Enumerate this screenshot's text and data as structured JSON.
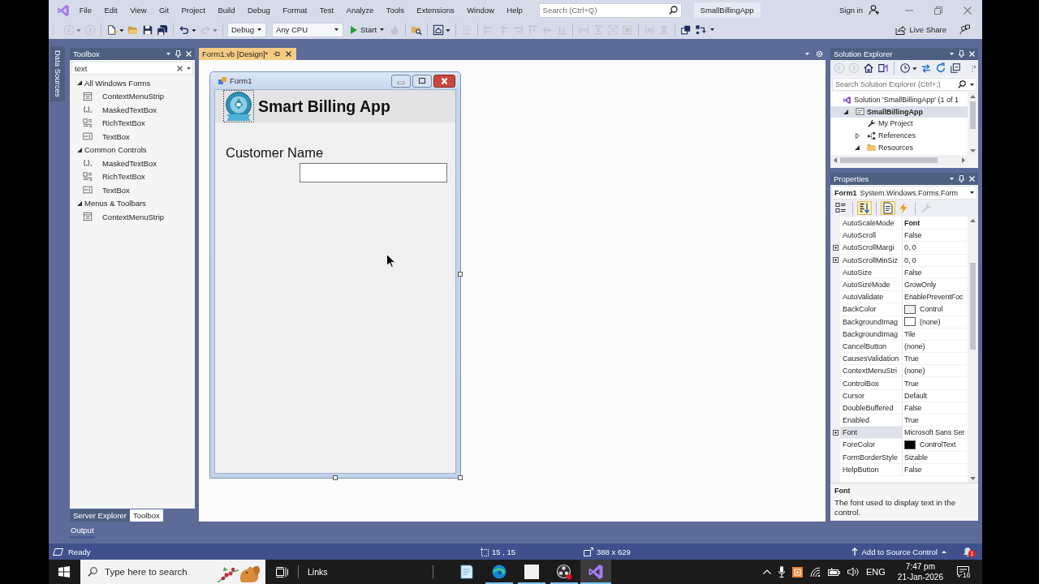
{
  "title_bar": {
    "menus": [
      "File",
      "Edit",
      "View",
      "Git",
      "Project",
      "Build",
      "Debug",
      "Format",
      "Test",
      "Analyze",
      "Tools",
      "Extensions",
      "Window",
      "Help"
    ],
    "search": {
      "placeholder": "Search (Ctrl+Q)"
    },
    "solution_name": "SmallBillingApp",
    "sign_in": "Sign in"
  },
  "toolbar": {
    "groups_left": [
      [
        {
          "kind": "back",
          "disabled": true,
          "menu": true
        },
        {
          "kind": "forward",
          "disabled": true,
          "menu": false
        }
      ],
      [
        {
          "kind": "new-item",
          "disabled": false,
          "menu": true
        },
        {
          "kind": "open",
          "disabled": false,
          "menu": false
        },
        {
          "kind": "save",
          "disabled": false,
          "menu": false
        },
        {
          "kind": "save-all",
          "disabled": false,
          "menu": false
        }
      ],
      [
        {
          "kind": "undo",
          "disabled": false,
          "menu": true
        },
        {
          "kind": "redo",
          "disabled": true,
          "menu": true
        }
      ]
    ],
    "configuration": "Debug",
    "platform": "Any CPU",
    "start": "Start",
    "groups_right": [
      [
        {
          "kind": "hot-reload",
          "disabled": true,
          "menu": false
        }
      ],
      [
        {
          "kind": "find",
          "disabled": false,
          "menu": false
        }
      ],
      [
        {
          "kind": "layout",
          "disabled": false,
          "menu": true
        }
      ],
      [
        {
          "kind": "align-grid",
          "disabled": true,
          "menu": false
        }
      ],
      [
        {
          "kind": "align-left",
          "disabled": true,
          "menu": false
        },
        {
          "kind": "align-center",
          "disabled": true,
          "menu": false
        },
        {
          "kind": "align-right",
          "disabled": true,
          "menu": false
        },
        {
          "kind": "align-top",
          "disabled": true,
          "menu": false
        },
        {
          "kind": "align-middle",
          "disabled": true,
          "menu": false
        },
        {
          "kind": "align-bottom",
          "disabled": true,
          "menu": false
        }
      ],
      [
        {
          "kind": "same-width",
          "disabled": true,
          "menu": false
        },
        {
          "kind": "same-height",
          "disabled": true,
          "menu": false
        },
        {
          "kind": "same-size",
          "disabled": true,
          "menu": false
        },
        {
          "kind": "size-grid",
          "disabled": true,
          "menu": false
        }
      ],
      [
        {
          "kind": "h-spacing",
          "disabled": true,
          "menu": false
        },
        {
          "kind": "v-spacing",
          "disabled": true,
          "menu": false
        }
      ],
      [
        {
          "kind": "bring-front",
          "disabled": false,
          "menu": false
        },
        {
          "kind": "tab-order",
          "disabled": false,
          "menu": false
        }
      ]
    ],
    "live_share": "Live Share"
  },
  "data_sources_tab": {
    "label": "Data Sources"
  },
  "toolbox": {
    "title": "Toolbox",
    "search": {
      "value": "text"
    },
    "groups": [
      {
        "label": "All Windows Forms",
        "expanded": true,
        "items": [
          {
            "label": "ContextMenuStrip",
            "kind": "menu"
          },
          {
            "label": "MaskedTextBox",
            "kind": "masked"
          },
          {
            "label": "RichTextBox",
            "kind": "rich"
          },
          {
            "label": "TextBox",
            "kind": "textbox"
          }
        ]
      },
      {
        "label": "Common Controls",
        "expanded": true,
        "items": [
          {
            "label": "MaskedTextBox",
            "kind": "masked"
          },
          {
            "label": "RichTextBox",
            "kind": "rich"
          },
          {
            "label": "TextBox",
            "kind": "textbox"
          }
        ]
      },
      {
        "label": "Menus & Toolbars",
        "expanded": true,
        "items": [
          {
            "label": "ContextMenuStrip",
            "kind": "menu"
          }
        ]
      }
    ],
    "tabs": [
      {
        "label": "Server Explorer",
        "selected": false
      },
      {
        "label": "Toolbox",
        "selected": true
      }
    ]
  },
  "output_tab": {
    "label": "Output"
  },
  "document_tab": {
    "label": "Form1.vb [Design]*",
    "selected": true
  },
  "form": {
    "title": "Form1",
    "heading": "Smart Billing App",
    "field_label": "Customer Name"
  },
  "solution_explorer": {
    "title": "Solution Explorer",
    "tool_groups": [
      [
        {
          "kind": "back",
          "disabled": true,
          "menu": false
        },
        {
          "kind": "forward",
          "disabled": true,
          "menu": false
        },
        {
          "kind": "home",
          "disabled": false,
          "menu": false
        },
        {
          "kind": "switch-views",
          "disabled": false,
          "menu": false
        }
      ],
      [
        {
          "kind": "history",
          "disabled": false,
          "menu": true
        },
        {
          "kind": "sync",
          "disabled": false,
          "menu": false
        },
        {
          "kind": "refresh",
          "disabled": false,
          "menu": false
        },
        {
          "kind": "collapse",
          "disabled": false,
          "menu": false
        }
      ]
    ],
    "search": {
      "placeholder": "Search Solution Explorer (Ctrl+;)"
    },
    "tree": [
      {
        "label": "Solution 'SmallBillingApp' (1 of 1",
        "kind": "solution",
        "selected": false,
        "startup": false,
        "children": [
          {
            "label": "SmallBillingApp",
            "kind": "project",
            "expanded": true,
            "selected": true,
            "startup": true,
            "children": [
              {
                "label": "My Project",
                "kind": "settings",
                "selected": false,
                "startup": false
              },
              {
                "label": "References",
                "kind": "references",
                "expanded": false,
                "selected": false,
                "startup": false
              },
              {
                "label": "Resources",
                "kind": "folder",
                "expanded": true,
                "selected": false,
                "startup": false
              }
            ]
          }
        ]
      }
    ]
  },
  "properties": {
    "title": "Properties",
    "object": {
      "name": "Form1",
      "type": "System.Windows.Forms.Form"
    },
    "view_button_groups": [
      [
        {
          "kind": "categorized",
          "selected": false,
          "disabled": false
        }
      ],
      [
        {
          "kind": "alphabetical",
          "selected": true,
          "disabled": false
        }
      ],
      [
        {
          "kind": "properties",
          "selected": true,
          "disabled": false
        },
        {
          "kind": "events",
          "selected": false,
          "disabled": false
        }
      ],
      [
        {
          "kind": "pages",
          "selected": false,
          "disabled": true
        }
      ]
    ],
    "rows": [
      {
        "name": "AutoScaleMode",
        "value": "Font",
        "modified": true,
        "expandable": false,
        "selected": false
      },
      {
        "name": "AutoScroll",
        "value": "False",
        "modified": false,
        "expandable": false,
        "selected": false
      },
      {
        "name": "AutoScrollMargi",
        "value": "0, 0",
        "modified": false,
        "expandable": true,
        "selected": false
      },
      {
        "name": "AutoScrollMinSiz",
        "value": "0, 0",
        "modified": false,
        "expandable": true,
        "selected": false
      },
      {
        "name": "AutoSize",
        "value": "False",
        "modified": false,
        "expandable": false,
        "selected": false
      },
      {
        "name": "AutoSizeMode",
        "value": "GrowOnly",
        "modified": false,
        "expandable": false,
        "selected": false
      },
      {
        "name": "AutoValidate",
        "value": "EnablePreventFoc",
        "modified": false,
        "expandable": false,
        "selected": false
      },
      {
        "name": "BackColor",
        "value": "Control",
        "color": "#f0f0f0",
        "modified": false,
        "expandable": false,
        "selected": false
      },
      {
        "name": "BackgroundImag",
        "value": "(none)",
        "color": "#ffffff",
        "modified": false,
        "expandable": false,
        "selected": false
      },
      {
        "name": "BackgroundImag",
        "value": "Tile",
        "modified": false,
        "expandable": false,
        "selected": false
      },
      {
        "name": "CancelButton",
        "value": "(none)",
        "modified": false,
        "expandable": false,
        "selected": false
      },
      {
        "name": "CausesValidation",
        "value": "True",
        "modified": false,
        "expandable": false,
        "selected": false
      },
      {
        "name": "ContextMenuStri",
        "value": "(none)",
        "modified": false,
        "expandable": false,
        "selected": false
      },
      {
        "name": "ControlBox",
        "value": "True",
        "modified": false,
        "expandable": false,
        "selected": false
      },
      {
        "name": "Cursor",
        "value": "Default",
        "modified": false,
        "expandable": false,
        "selected": false
      },
      {
        "name": "DoubleBuffered",
        "value": "False",
        "modified": false,
        "expandable": false,
        "selected": false
      },
      {
        "name": "Enabled",
        "value": "True",
        "modified": false,
        "expandable": false,
        "selected": false
      },
      {
        "name": "Font",
        "value": "Microsoft Sans Ser",
        "modified": false,
        "expandable": true,
        "selected": true
      },
      {
        "name": "ForeColor",
        "value": "ControlText",
        "color": "#000000",
        "modified": false,
        "expandable": false,
        "selected": false
      },
      {
        "name": "FormBorderStyle",
        "value": "Sizable",
        "modified": false,
        "expandable": false,
        "selected": false
      },
      {
        "name": "HelpButton",
        "value": "False",
        "modified": false,
        "expandable": false,
        "selected": false
      }
    ],
    "description": {
      "title": "Font",
      "text": "The font used to display text in the control."
    }
  },
  "status_bar": {
    "state": "Ready",
    "position": "15 , 15",
    "size": "388 x 629",
    "source_control": "Add to Source Control",
    "notification_count": "1"
  },
  "taskbar": {
    "search": {
      "placeholder": "Type here to search"
    },
    "links": "Links",
    "apps": [
      {
        "kind": "notepad",
        "running": false,
        "active": false
      },
      {
        "kind": "browser",
        "running": true,
        "active": false
      },
      {
        "kind": "whiteboard",
        "running": true,
        "active": false
      },
      {
        "kind": "recorder",
        "running": true,
        "active": false
      },
      {
        "kind": "ide",
        "running": true,
        "active": true
      }
    ],
    "language": "ENG",
    "time": "7:47 pm",
    "date": "21-Jan-2026",
    "notification_count": "16"
  }
}
